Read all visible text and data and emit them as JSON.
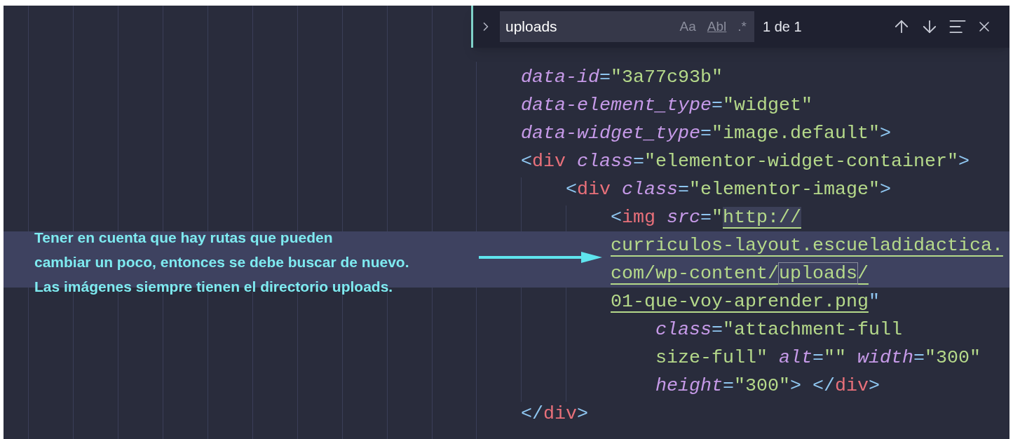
{
  "find_widget": {
    "expanded": false,
    "query": "uploads",
    "options": [
      {
        "label": "Aa",
        "selected": false
      },
      {
        "label": "Abl",
        "selected": false
      },
      {
        "label": ".*",
        "selected": false
      }
    ],
    "count": "1 de 1"
  },
  "code_lines": [
    {
      "highlighted": false,
      "tokens": [
        {
          "kind": "attr",
          "text": "data-id"
        },
        {
          "kind": "punct",
          "text": "="
        },
        {
          "kind": "string",
          "text": "\"3a77c93b\""
        }
      ]
    },
    {
      "highlighted": false,
      "tokens": [
        {
          "kind": "attr",
          "text": "data-element_type"
        },
        {
          "kind": "punct",
          "text": "="
        },
        {
          "kind": "string",
          "text": "\"widget\""
        }
      ]
    },
    {
      "highlighted": false,
      "tokens": [
        {
          "kind": "attr",
          "text": "data-widget_type"
        },
        {
          "kind": "punct",
          "text": "="
        },
        {
          "kind": "string",
          "text": "\"image.default\""
        },
        {
          "kind": "punct",
          "text": ">"
        }
      ]
    },
    {
      "highlighted": false,
      "tokens": [
        {
          "kind": "punct",
          "text": "<"
        },
        {
          "kind": "tag",
          "text": "div"
        },
        {
          "kind": "gap"
        },
        {
          "kind": "attr",
          "text": "class"
        },
        {
          "kind": "punct",
          "text": "="
        },
        {
          "kind": "string",
          "text": "\"elementor-widget-container\""
        },
        {
          "kind": "punct",
          "text": ">"
        }
      ],
      "children": [
        {
          "highlighted": false,
          "tokens": [
            {
              "kind": "punct",
              "text": "<"
            },
            {
              "kind": "tag",
              "text": "div"
            },
            {
              "kind": "gap"
            },
            {
              "kind": "attr",
              "text": "class"
            },
            {
              "kind": "punct",
              "text": "="
            },
            {
              "kind": "string",
              "text": "\"elementor-image\""
            },
            {
              "kind": "punct",
              "text": ">"
            }
          ],
          "children": [
            {
              "highlighted": false,
              "tokens": [
                {
                  "kind": "punct",
                  "text": "<"
                },
                {
                  "kind": "tag",
                  "text": "img"
                },
                {
                  "kind": "gap"
                },
                {
                  "kind": "attr",
                  "text": "src"
                },
                {
                  "kind": "punct",
                  "text": "="
                },
                {
                  "kind": "string",
                  "text": "\""
                },
                {
                  "kind": "url-selected",
                  "text": "http://"
                }
              ]
            },
            {
              "highlighted": true,
              "tokens": [
                {
                  "kind": "url",
                  "text": "curriculos-layout.escueladidactica."
                }
              ]
            },
            {
              "highlighted": true,
              "tokens": [
                {
                  "kind": "url",
                  "text": "com/wp-content/"
                },
                {
                  "kind": "url-match",
                  "text": "uploads"
                },
                {
                  "kind": "url",
                  "text": "/"
                }
              ]
            },
            {
              "highlighted": false,
              "tokens": [
                {
                  "kind": "url",
                  "text": "01-que-voy-aprender.png"
                },
                {
                  "kind": "punct",
                  "text": "\""
                }
              ],
              "children": [
                {
                  "highlighted": false,
                  "tokens": [
                    {
                      "kind": "attr",
                      "text": "class"
                    },
                    {
                      "kind": "punct",
                      "text": "="
                    },
                    {
                      "kind": "string",
                      "text": "\"attachment-full"
                    }
                  ]
                },
                {
                  "highlighted": false,
                  "tokens": [
                    {
                      "kind": "string",
                      "text": "size-full\""
                    },
                    {
                      "kind": "gap"
                    },
                    {
                      "kind": "attr",
                      "text": "alt"
                    },
                    {
                      "kind": "punct",
                      "text": "="
                    },
                    {
                      "kind": "string",
                      "text": "\"\""
                    },
                    {
                      "kind": "gap"
                    },
                    {
                      "kind": "attr",
                      "text": "width"
                    },
                    {
                      "kind": "punct",
                      "text": "="
                    },
                    {
                      "kind": "string",
                      "text": "\"300\""
                    }
                  ]
                },
                {
                  "highlighted": false,
                  "tokens": [
                    {
                      "kind": "attr",
                      "text": "height"
                    },
                    {
                      "kind": "punct",
                      "text": "="
                    },
                    {
                      "kind": "string",
                      "text": "\"300\""
                    },
                    {
                      "kind": "punct",
                      "text": ">"
                    },
                    {
                      "kind": "gap"
                    },
                    {
                      "kind": "punct",
                      "text": "</"
                    },
                    {
                      "kind": "tag",
                      "text": "div"
                    },
                    {
                      "kind": "punct",
                      "text": ">"
                    }
                  ]
                }
              ]
            }
          ]
        }
      ]
    },
    {
      "highlighted": false,
      "tokens": [
        {
          "kind": "punct",
          "text": "</"
        },
        {
          "kind": "tag",
          "text": "div"
        },
        {
          "kind": "punct",
          "text": ">"
        }
      ]
    }
  ],
  "annotation": {
    "lines": [
      "Tener en cuenta que hay rutas que pueden",
      "cambiar un poco, entonces se debe buscar de nuevo.",
      "Las imágenes siempre tienen el directorio uploads."
    ]
  }
}
